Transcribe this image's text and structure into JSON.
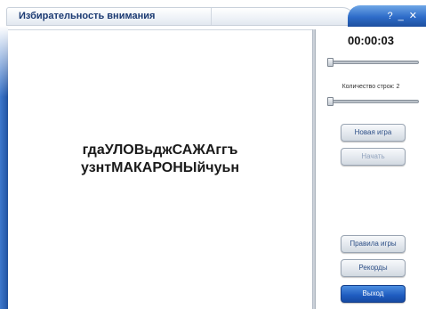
{
  "window": {
    "title": "Избирательность внимания",
    "controls": [
      "?",
      "_",
      "✕"
    ]
  },
  "game": {
    "lines": [
      "гдаУЛОВьджСАЖАггъ",
      "узнтМАКАРОНЫйчуьн"
    ]
  },
  "panel": {
    "timer": "00:00:03",
    "speed_slider_value": 0,
    "rows_label": "Количество строк: 2",
    "rows_slider_value": 0,
    "buttons": {
      "new_game": "Новая игра",
      "start": "Начать",
      "rules": "Правила игры",
      "records": "Рекорды",
      "exit": "Выход"
    }
  },
  "colors": {
    "accent_blue": "#2e6cc9",
    "title_text": "#1b3a72",
    "button_text": "#2d4f86"
  }
}
